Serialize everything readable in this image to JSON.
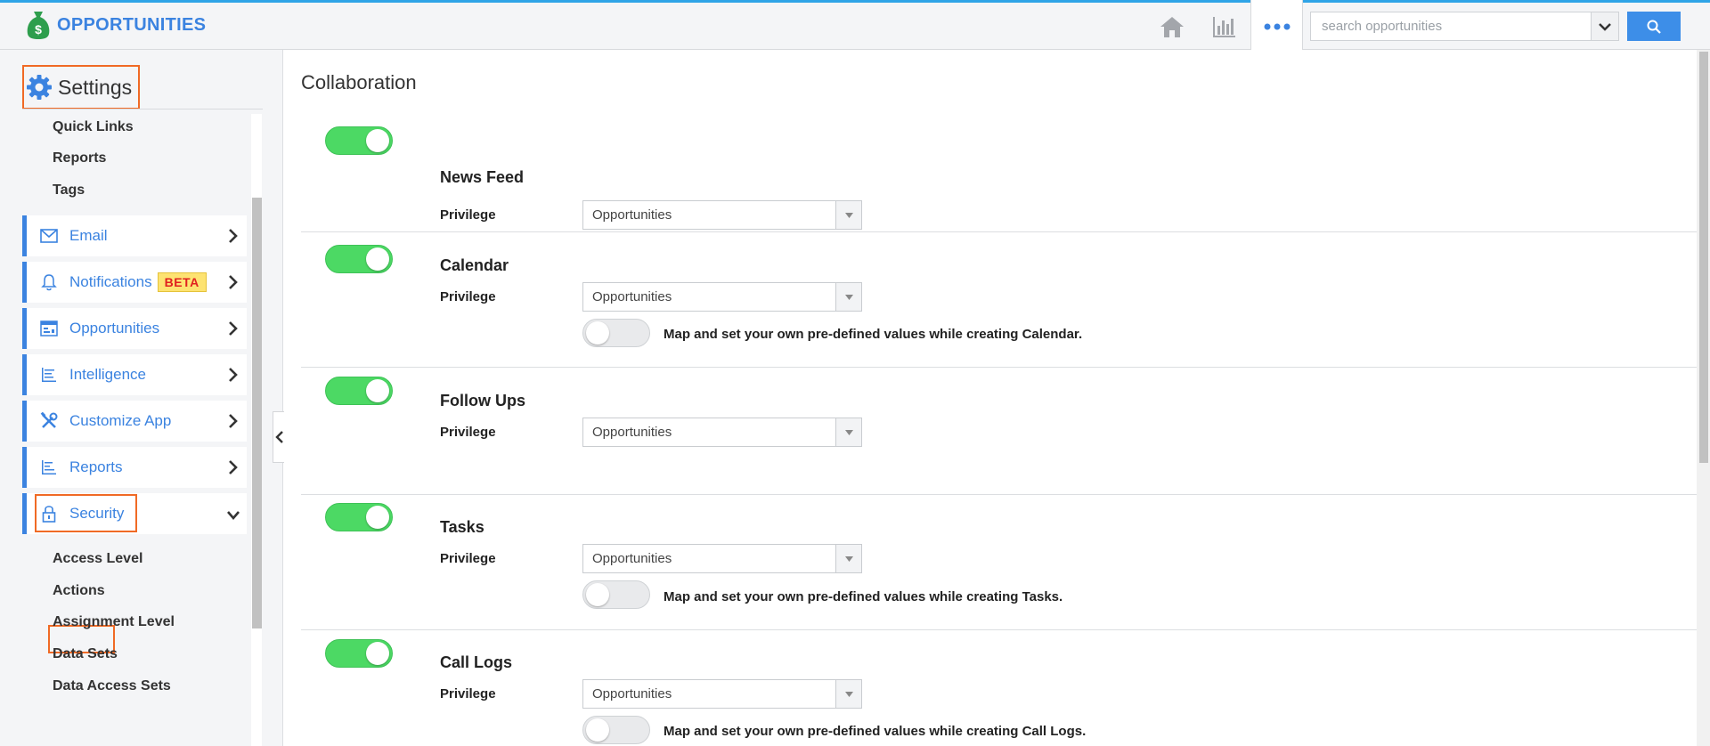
{
  "app": {
    "title": "OPPORTUNITIES"
  },
  "header": {
    "search_placeholder": "search opportunities",
    "icons": [
      "home-icon",
      "chart-icon",
      "more-icon",
      "chevron-down-icon",
      "search-icon"
    ]
  },
  "sidebar": {
    "title": "Settings",
    "quick_links": [
      "Quick Links",
      "Reports",
      "Tags"
    ],
    "nav": [
      {
        "label": "Email",
        "icon": "envelope-icon"
      },
      {
        "label": "Notifications",
        "icon": "bell-icon",
        "badge": "BETA"
      },
      {
        "label": "Opportunities",
        "icon": "opportunities-icon"
      },
      {
        "label": "Intelligence",
        "icon": "intelligence-icon"
      },
      {
        "label": "Customize App",
        "icon": "tools-icon"
      },
      {
        "label": "Reports",
        "icon": "reports-icon"
      },
      {
        "label": "Security",
        "icon": "lock-icon",
        "expanded": true
      }
    ],
    "security_sub": [
      "Access Level",
      "Actions",
      "Assignment Level",
      "Data Sets",
      "Data Access Sets"
    ]
  },
  "main": {
    "title": "Collaboration",
    "sections": [
      {
        "name": "News Feed",
        "enabled": true,
        "privilege_label": "Privilege",
        "privilege_value": "Opportunities"
      },
      {
        "name": "Calendar",
        "enabled": true,
        "privilege_label": "Privilege",
        "privilege_value": "Opportunities",
        "map_text": "Map and set your own pre-defined values while creating Calendar.",
        "map_enabled": false
      },
      {
        "name": "Follow Ups",
        "enabled": true,
        "privilege_label": "Privilege",
        "privilege_value": "Opportunities"
      },
      {
        "name": "Tasks",
        "enabled": true,
        "privilege_label": "Privilege",
        "privilege_value": "Opportunities",
        "map_text": "Map and set your own pre-defined values while creating Tasks.",
        "map_enabled": false
      },
      {
        "name": "Call Logs",
        "enabled": true,
        "privilege_label": "Privilege",
        "privilege_value": "Opportunities",
        "map_text": "Map and set your own pre-defined values while creating Call Logs.",
        "map_enabled": false
      }
    ]
  },
  "colors": {
    "accent": "#3b83e0",
    "toggle_on": "#4cd964",
    "highlight": "#f06a25",
    "badge_bg": "#fde372",
    "badge_text": "#e02020"
  }
}
